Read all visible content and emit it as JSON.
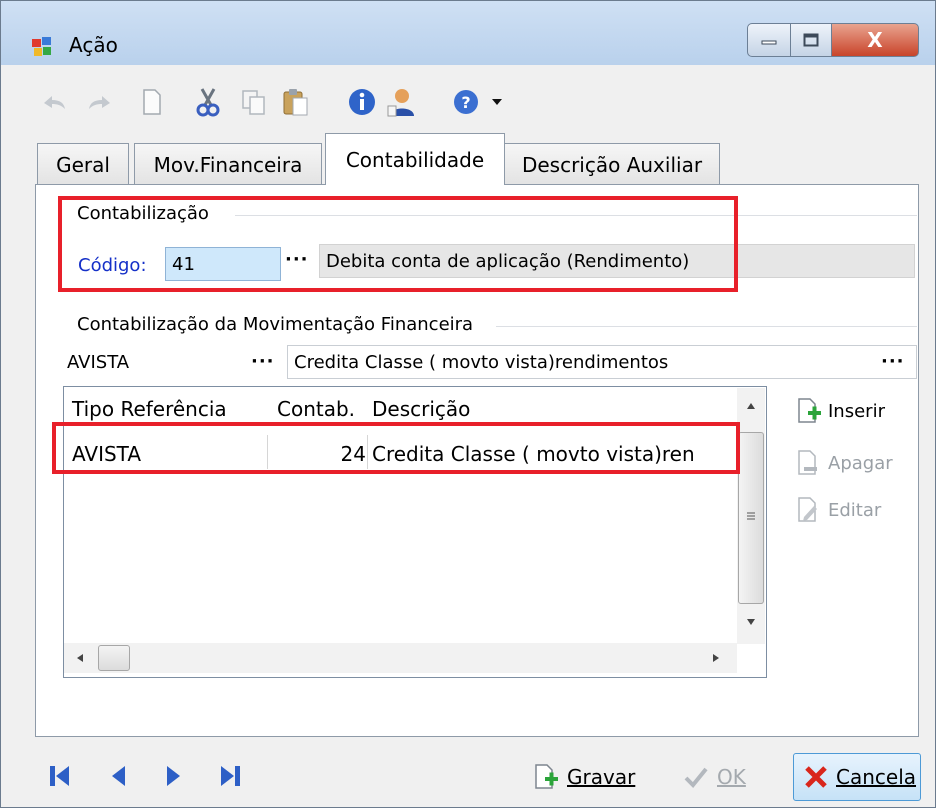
{
  "window": {
    "title": "Ação",
    "minimize_label": "",
    "maximize_label": "",
    "close_label": "X"
  },
  "toolbar": {
    "icons": [
      "undo-icon",
      "redo-icon",
      "new-document-icon",
      "cut-icon",
      "copy-icon",
      "paste-icon",
      "info-icon",
      "user-icon",
      "help-icon",
      "dropdown-arrow-icon"
    ]
  },
  "tabs": [
    {
      "label": "Geral"
    },
    {
      "label": "Mov.Financeira"
    },
    {
      "label": "Contabilidade"
    },
    {
      "label": "Descrição Auxiliar"
    }
  ],
  "contabilizacao": {
    "group_title": "Contabilização",
    "codigo_label": "Código:",
    "codigo_value": "41",
    "lookup_button": "···",
    "descricao": "Debita conta de aplicação (Rendimento)"
  },
  "mov_financeira": {
    "group_title": "Contabilização da Movimentação Financeira",
    "tipo_value": "AVISTA",
    "tipo_lookup": "···",
    "descricao_value": "Credita Classe ( movto vista)rendimentos",
    "descricao_lookup": "···"
  },
  "grid": {
    "columns": [
      "Tipo Referência",
      "Contab.",
      "Descrição"
    ],
    "rows": [
      {
        "tipo": "AVISTA",
        "contab": "24",
        "descricao": "Credita Classe ( movto vista)ren"
      }
    ]
  },
  "side_actions": {
    "inserir": "Inserir",
    "apagar": "Apagar",
    "editar": "Editar"
  },
  "bottom": {
    "gravar": "Gravar",
    "ok": "OK",
    "cancela": "Cancela"
  },
  "colors": {
    "accent_blue": "#1530c8",
    "highlight_red": "#e8202a",
    "input_blue": "#cfe8fb"
  }
}
